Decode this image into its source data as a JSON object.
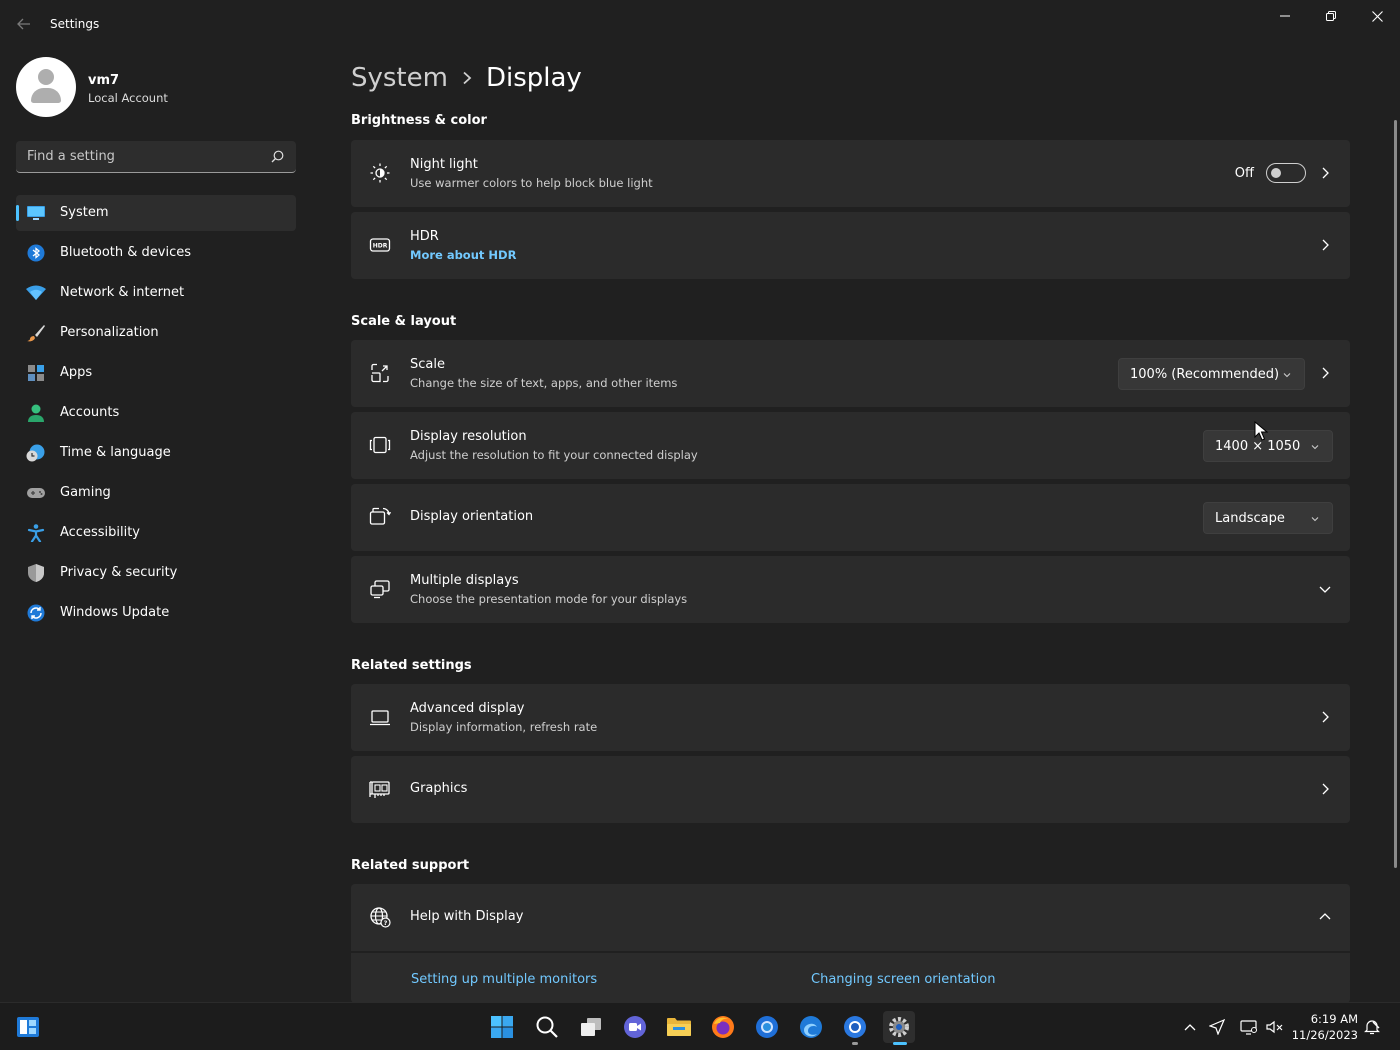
{
  "window": {
    "title": "Settings"
  },
  "user": {
    "name": "vm7",
    "account_type": "Local Account"
  },
  "search": {
    "placeholder": "Find a setting"
  },
  "sidebar": {
    "items": [
      {
        "label": "System",
        "icon": "monitor-icon",
        "active": true
      },
      {
        "label": "Bluetooth & devices",
        "icon": "bluetooth-icon"
      },
      {
        "label": "Network & internet",
        "icon": "wifi-icon"
      },
      {
        "label": "Personalization",
        "icon": "paintbrush-icon"
      },
      {
        "label": "Apps",
        "icon": "apps-icon"
      },
      {
        "label": "Accounts",
        "icon": "person-icon"
      },
      {
        "label": "Time & language",
        "icon": "globe-clock-icon"
      },
      {
        "label": "Gaming",
        "icon": "gamepad-icon"
      },
      {
        "label": "Accessibility",
        "icon": "accessibility-icon"
      },
      {
        "label": "Privacy & security",
        "icon": "shield-icon"
      },
      {
        "label": "Windows Update",
        "icon": "update-icon"
      }
    ]
  },
  "breadcrumb": {
    "parent": "System",
    "current": "Display"
  },
  "sections": {
    "brightness": "Brightness & color",
    "scale_layout": "Scale & layout",
    "related_settings": "Related settings",
    "related_support": "Related support"
  },
  "night_light": {
    "title": "Night light",
    "subtitle": "Use warmer colors to help block blue light",
    "state_label": "Off",
    "on": false
  },
  "hdr": {
    "title": "HDR",
    "link": "More about HDR"
  },
  "scale": {
    "title": "Scale",
    "subtitle": "Change the size of text, apps, and other items",
    "value": "100% (Recommended)"
  },
  "resolution": {
    "title": "Display resolution",
    "subtitle": "Adjust the resolution to fit your connected display",
    "value": "1400 × 1050"
  },
  "orientation": {
    "title": "Display orientation",
    "value": "Landscape"
  },
  "multiple_displays": {
    "title": "Multiple displays",
    "subtitle": "Choose the presentation mode for your displays"
  },
  "advanced_display": {
    "title": "Advanced display",
    "subtitle": "Display information, refresh rate"
  },
  "graphics": {
    "title": "Graphics"
  },
  "help": {
    "title": "Help with Display",
    "links": [
      "Setting up multiple monitors",
      "Changing screen orientation"
    ]
  },
  "taskbar": {
    "time": "6:19 AM",
    "date": "11/26/2023"
  },
  "colors": {
    "accent": "#4cc2ff",
    "link": "#72c9ff",
    "background": "#202020",
    "card": "#2b2b2b"
  }
}
